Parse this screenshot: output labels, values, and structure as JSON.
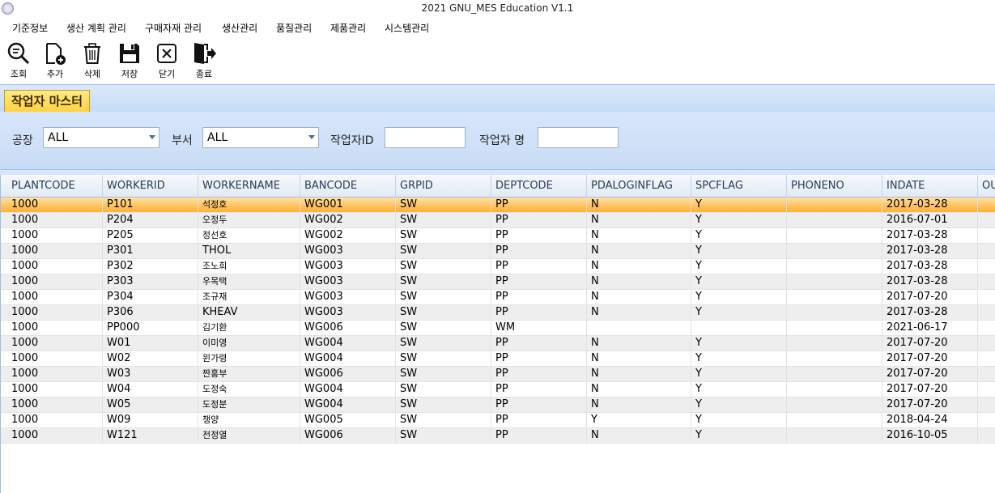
{
  "window": {
    "title": "2021 GNU_MES Education V1.1"
  },
  "menu": [
    {
      "label": "기준정보"
    },
    {
      "label": "생산 계획 관리"
    },
    {
      "label": "구매자재 관리"
    },
    {
      "label": "생산관리"
    },
    {
      "label": "품질관리"
    },
    {
      "label": "제품관리"
    },
    {
      "label": "시스템관리"
    }
  ],
  "toolbar": {
    "search_label": "조회",
    "add_label": "추가",
    "delete_label": "삭제",
    "save_label": "저장",
    "close_label": "닫기",
    "exit_label": "종료"
  },
  "tab": {
    "label": "작업자 마스터"
  },
  "filters": {
    "plant_label": "공장",
    "plant_value": "ALL",
    "dept_label": "부서",
    "dept_value": "ALL",
    "worker_id_label": "작업자ID",
    "worker_id_value": "",
    "worker_name_label": "작업자 명",
    "worker_name_value": ""
  },
  "grid": {
    "columns": [
      "PLANTCODE",
      "WORKERID",
      "WORKERNAME",
      "BANCODE",
      "GRPID",
      "DEPTCODE",
      "PDALOGINFLAG",
      "SPCFLAG",
      "PHONENO",
      "INDATE",
      "OU"
    ],
    "rows": [
      [
        "1000",
        "P101",
        "석정호",
        "WG001",
        "SW",
        "PP",
        "N",
        "Y",
        "",
        "2017-03-28"
      ],
      [
        "1000",
        "P204",
        "오정두",
        "WG002",
        "SW",
        "PP",
        "N",
        "Y",
        "",
        "2016-07-01"
      ],
      [
        "1000",
        "P205",
        "정선호",
        "WG002",
        "SW",
        "PP",
        "N",
        "Y",
        "",
        "2017-03-28"
      ],
      [
        "1000",
        "P301",
        "THOL",
        "WG003",
        "SW",
        "PP",
        "N",
        "Y",
        "",
        "2017-03-28"
      ],
      [
        "1000",
        "P302",
        "조노희",
        "WG003",
        "SW",
        "PP",
        "N",
        "Y",
        "",
        "2017-03-28"
      ],
      [
        "1000",
        "P303",
        "우목택",
        "WG003",
        "SW",
        "PP",
        "N",
        "Y",
        "",
        "2017-03-28"
      ],
      [
        "1000",
        "P304",
        "조규재",
        "WG003",
        "SW",
        "PP",
        "N",
        "Y",
        "",
        "2017-07-20"
      ],
      [
        "1000",
        "P306",
        "KHEAV",
        "WG003",
        "SW",
        "PP",
        "N",
        "Y",
        "",
        "2017-03-28"
      ],
      [
        "1000",
        "PP000",
        "김기환",
        "WG006",
        "SW",
        "WM",
        "",
        "",
        "",
        "2021-06-17"
      ],
      [
        "1000",
        "W01",
        "이미영",
        "WG004",
        "SW",
        "PP",
        "N",
        "Y",
        "",
        "2017-07-20"
      ],
      [
        "1000",
        "W02",
        "윈가령",
        "WG004",
        "SW",
        "PP",
        "N",
        "Y",
        "",
        "2017-07-20"
      ],
      [
        "1000",
        "W03",
        "짠홍부",
        "WG006",
        "SW",
        "PP",
        "N",
        "Y",
        "",
        "2017-07-20"
      ],
      [
        "1000",
        "W04",
        "도정숙",
        "WG004",
        "SW",
        "PP",
        "N",
        "Y",
        "",
        "2017-07-20"
      ],
      [
        "1000",
        "W05",
        "도정분",
        "WG004",
        "SW",
        "PP",
        "N",
        "Y",
        "",
        "2017-07-20"
      ],
      [
        "1000",
        "W09",
        "챙양",
        "WG005",
        "SW",
        "PP",
        "Y",
        "Y",
        "",
        "2018-04-24"
      ],
      [
        "1000",
        "W121",
        "전정열",
        "WG006",
        "SW",
        "PP",
        "N",
        "Y",
        "",
        "2016-10-05"
      ]
    ],
    "selected_row": 0
  }
}
